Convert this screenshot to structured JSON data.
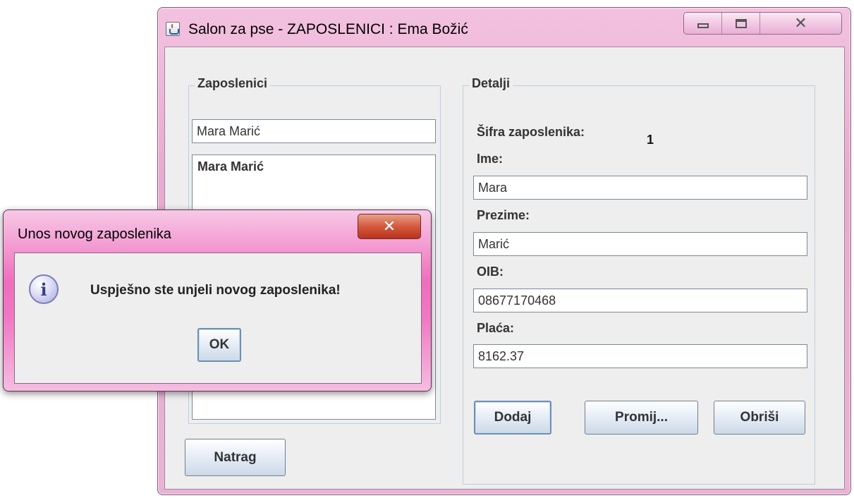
{
  "window": {
    "title": "Salon za pse - ZAPOSLENICI : Ema Božić",
    "close_glyph": "✕"
  },
  "zaposlenici": {
    "legend": "Zaposlenici",
    "search_value": "Mara Marić",
    "list_items": [
      "Mara Marić"
    ],
    "back_button": "Natrag"
  },
  "detalji": {
    "legend": "Detalji",
    "id_label": "Šifra zaposlenika:",
    "id_value": "1",
    "ime_label": "Ime:",
    "ime_value": "Mara",
    "prezime_label": "Prezime:",
    "prezime_value": "Marić",
    "oib_label": "OIB:",
    "oib_value": "08677170468",
    "placa_label": "Plaća:",
    "placa_value": "8162.37",
    "add_button": "Dodaj",
    "change_button": "Promij...",
    "delete_button": "Obriši"
  },
  "dialog": {
    "title": "Unos novog zaposlenika",
    "close_glyph": "✕",
    "icon_glyph": "i",
    "message": "Uspješno ste unjeli novog zaposlenika!",
    "ok_button": "OK"
  }
}
